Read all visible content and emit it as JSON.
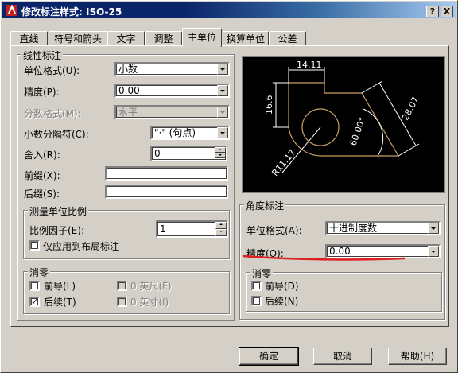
{
  "window": {
    "title": "修改标注样式: ISO-25",
    "help_btn": "?",
    "close_btn": "X"
  },
  "tabs": [
    "直线",
    "符号和箭头",
    "文字",
    "调整",
    "主单位",
    "换算单位",
    "公差"
  ],
  "linear": {
    "group_title": "线性标注",
    "unit_format_label": "单位格式(U):",
    "unit_format_value": "小数",
    "precision_label": "精度(P):",
    "precision_value": "0.00",
    "fraction_format_label": "分数格式(M):",
    "fraction_format_value": "水平",
    "decimal_sep_label": "小数分隔符(C):",
    "decimal_sep_value": "\"·\" (句点)",
    "roundoff_label": "舍入(R):",
    "roundoff_value": "0",
    "prefix_label": "前缀(X):",
    "prefix_value": "",
    "suffix_label": "后缀(S):",
    "suffix_value": ""
  },
  "scale": {
    "group_title": "测量单位比例",
    "factor_label": "比例因子(E):",
    "factor_value": "1",
    "layout_only_label": "仅应用到布局标注"
  },
  "zero_linear": {
    "group_title": "消零",
    "leading_label": "前导(L)",
    "trailing_label": "后续(T)",
    "feet_label": "0 英尺(F)",
    "inches_label": "0 英寸(I)"
  },
  "angular": {
    "group_title": "角度标注",
    "unit_format_label": "单位格式(A):",
    "unit_format_value": "十进制度数",
    "precision_label": "精度(O):",
    "precision_value": "0.00"
  },
  "zero_angular": {
    "group_title": "消零",
    "leading_label": "前导(D)",
    "trailing_label": "后续(N)"
  },
  "preview": {
    "dim_top": "14.11",
    "dim_left": "16.6",
    "dim_right": "28.07",
    "dim_angle": "60.00°",
    "dim_radius": "R11.17"
  },
  "buttons": {
    "ok": "确定",
    "cancel": "取消",
    "help": "帮助(H)"
  },
  "colors": {
    "title_bar": "#0a246a",
    "face": "#d4d0c8",
    "annotation_underline": "#e02020",
    "preview_line": "#ffffff",
    "preview_shape": "#c8a060"
  }
}
